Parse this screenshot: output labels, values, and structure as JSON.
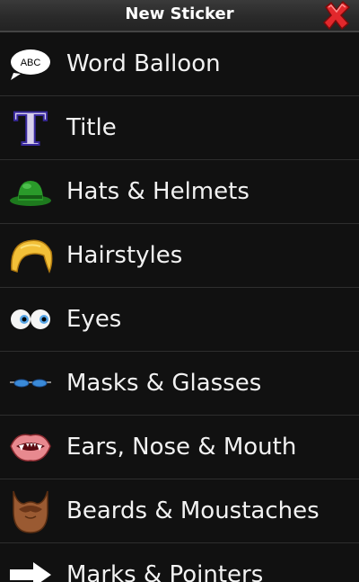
{
  "header": {
    "title": "New Sticker"
  },
  "items": [
    {
      "label": "Word Balloon",
      "icon": "speech-balloon-icon"
    },
    {
      "label": "Title",
      "icon": "letter-t-icon"
    },
    {
      "label": "Hats & Helmets",
      "icon": "green-hat-icon"
    },
    {
      "label": "Hairstyles",
      "icon": "blonde-hair-icon"
    },
    {
      "label": "Eyes",
      "icon": "eyes-icon"
    },
    {
      "label": "Masks & Glasses",
      "icon": "glasses-icon"
    },
    {
      "label": "Ears, Nose & Mouth",
      "icon": "mouth-icon"
    },
    {
      "label": "Beards & Moustaches",
      "icon": "beard-icon"
    },
    {
      "label": "Marks & Pointers",
      "icon": "arrow-icon"
    }
  ],
  "balloon_text": "ABC",
  "title_glyph": "T",
  "colors": {
    "close": "#e2282c",
    "title_letter": "#d8d0ec",
    "hat": "#2a9a2a",
    "hair": "#f2c038",
    "eye_iris": "#5aa8e8",
    "glasses": "#3a8ad8",
    "beard": "#9a5a32"
  }
}
